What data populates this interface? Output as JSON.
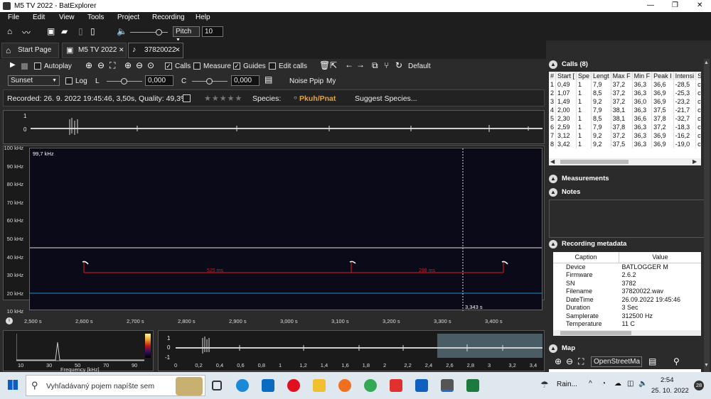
{
  "window": {
    "title": "M5 TV 2022 - BatExplorer",
    "controls": [
      "—",
      "❐",
      "✕"
    ]
  },
  "menu": [
    "File",
    "Edit",
    "View",
    "Tools",
    "Project",
    "Recording",
    "Help"
  ],
  "toolbar": {
    "pitch_label": "Pitch",
    "pitch_value": "10"
  },
  "tabs": [
    {
      "label": "Start Page"
    },
    {
      "label": "M5 TV 2022"
    },
    {
      "label": "37820022"
    }
  ],
  "player": {
    "autoplay": "Autoplay",
    "calls": "Calls",
    "measure": "Measure",
    "guides": "Guides",
    "edit_calls": "Edit calls",
    "default": "Default",
    "colormap": "Sunset",
    "log": "Log",
    "l_label": "L",
    "l_value": "0,000",
    "c_label": "C",
    "c_value": "0,000",
    "noise": "Noise",
    "ppip": "Ppip",
    "my": "My"
  },
  "info": {
    "recorded": "Recorded: 26. 9. 2022 19:45:46, 3,50s, Quality: 49,3%",
    "species_label": "Species:",
    "species_value": "Pkuh/Pnat",
    "suggest": "Suggest Species..."
  },
  "spectrogram": {
    "yticks": [
      "100 kHz",
      "90 kHz",
      "80 kHz",
      "70 kHz",
      "60 kHz",
      "50 kHz",
      "40 kHz",
      "30 kHz",
      "20 kHz",
      "10 kHz"
    ],
    "top_label": "99,7 kHz",
    "xticks": [
      "2,500 s",
      "2,600 s",
      "2,700 s",
      "2,800 s",
      "2,900 s",
      "3,000 s",
      "3,100 s",
      "3,200 s",
      "3,300 s",
      "3,400 s"
    ],
    "interval_labels": [
      "525 ms",
      "298 ms"
    ],
    "cursor_label": "3,343 s",
    "osc_yticks": [
      "1",
      "0"
    ]
  },
  "mini_spectrum": {
    "xticks": [
      "10",
      "30",
      "50",
      "70",
      "90"
    ],
    "xlabel": "Frequency [kHz]"
  },
  "overview": {
    "yticks": [
      "1",
      "0",
      "-1"
    ],
    "xticks": [
      "0",
      "0,2",
      "0,4",
      "0,6",
      "0,8",
      "1",
      "1,2",
      "1,4",
      "1,6",
      "1,8",
      "2",
      "2,2",
      "2,4",
      "2,6",
      "2,8",
      "3",
      "3,2",
      "3,4"
    ]
  },
  "calls": {
    "title": "Calls (8)",
    "columns": [
      "#",
      "Start [",
      "Spe",
      "Lengt",
      "Max F",
      "Min F",
      "Peak I",
      "Intensi",
      "Sha"
    ],
    "rows": [
      [
        "1",
        "0,49",
        "1",
        "7,9",
        "37,2",
        "36,3",
        "36,6",
        "-28,5",
        "cf-e"
      ],
      [
        "2",
        "1,07",
        "1",
        "8,5",
        "37,2",
        "36,3",
        "36,9",
        "-25,3",
        "cf-e"
      ],
      [
        "3",
        "1,49",
        "1",
        "9,2",
        "37,2",
        "36,0",
        "36,9",
        "-23,2",
        "cf-e"
      ],
      [
        "4",
        "2,00",
        "1",
        "7,9",
        "38,1",
        "36,3",
        "37,5",
        "-21,7",
        "cf-e"
      ],
      [
        "5",
        "2,30",
        "1",
        "8,5",
        "38,1",
        "36,6",
        "37,8",
        "-32,7",
        "cf-e"
      ],
      [
        "6",
        "2,59",
        "1",
        "7,9",
        "37,8",
        "36,3",
        "37,2",
        "-18,3",
        "cf-e"
      ],
      [
        "7",
        "3,12",
        "1",
        "9,2",
        "37,2",
        "36,3",
        "36,9",
        "-16,2",
        "cf-e"
      ],
      [
        "8",
        "3,42",
        "1",
        "9,2",
        "37,5",
        "36,3",
        "36,9",
        "-19,0",
        "cf-e"
      ]
    ]
  },
  "sections": {
    "measurements": "Measurements",
    "notes": "Notes",
    "metadata": "Recording metadata",
    "map": "Map"
  },
  "metadata": {
    "columns": [
      "Caption",
      "Value"
    ],
    "rows": [
      [
        "Device",
        "BATLOGGER M"
      ],
      [
        "Firmware",
        "2.6.2"
      ],
      [
        "SN",
        "3782"
      ],
      [
        "Filename",
        "37820022.wav"
      ],
      [
        "DateTime",
        "26.09.2022 19:45:46"
      ],
      [
        "Duration",
        "3 Sec"
      ],
      [
        "Samplerate",
        "312500 Hz"
      ],
      [
        "Temperature",
        "11 C"
      ]
    ]
  },
  "map": {
    "provider": "OpenStreetMa"
  },
  "taskbar": {
    "search": "Vyhľadávaný pojem napíšte sem",
    "weather": "Rain...",
    "time": "2:54",
    "date": "25. 10. 2022",
    "notif": "28"
  },
  "colors": {
    "call_line": "#e0191b",
    "guide_line": "#1e90d8",
    "spectro_bg": "#0a0a18",
    "species": "#f0a030"
  }
}
